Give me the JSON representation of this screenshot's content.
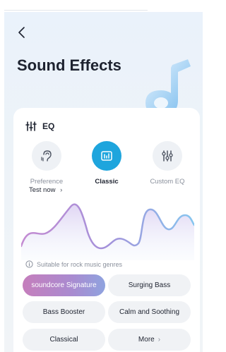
{
  "header": {
    "title": "Sound Effects"
  },
  "eq": {
    "title": "EQ",
    "modes": [
      {
        "label": "Preference",
        "icon": "ear-icon",
        "active": false
      },
      {
        "label": "Classic",
        "icon": "equalizer-card-icon",
        "active": true
      },
      {
        "label": "Custom EQ",
        "icon": "sliders-icon",
        "active": false
      }
    ],
    "test_now": "Test now",
    "tip": "Suitable for rock music genres",
    "presets": [
      "soundcore Signature",
      "Surging Bass",
      "Bass Booster",
      "Calm and Soothing",
      "Classical",
      "More"
    ],
    "selected_preset": "soundcore Signature"
  },
  "colors": {
    "accent": "#1ea5dd",
    "wave_start": "#b68fd6",
    "wave_end": "#8fc3ee"
  }
}
